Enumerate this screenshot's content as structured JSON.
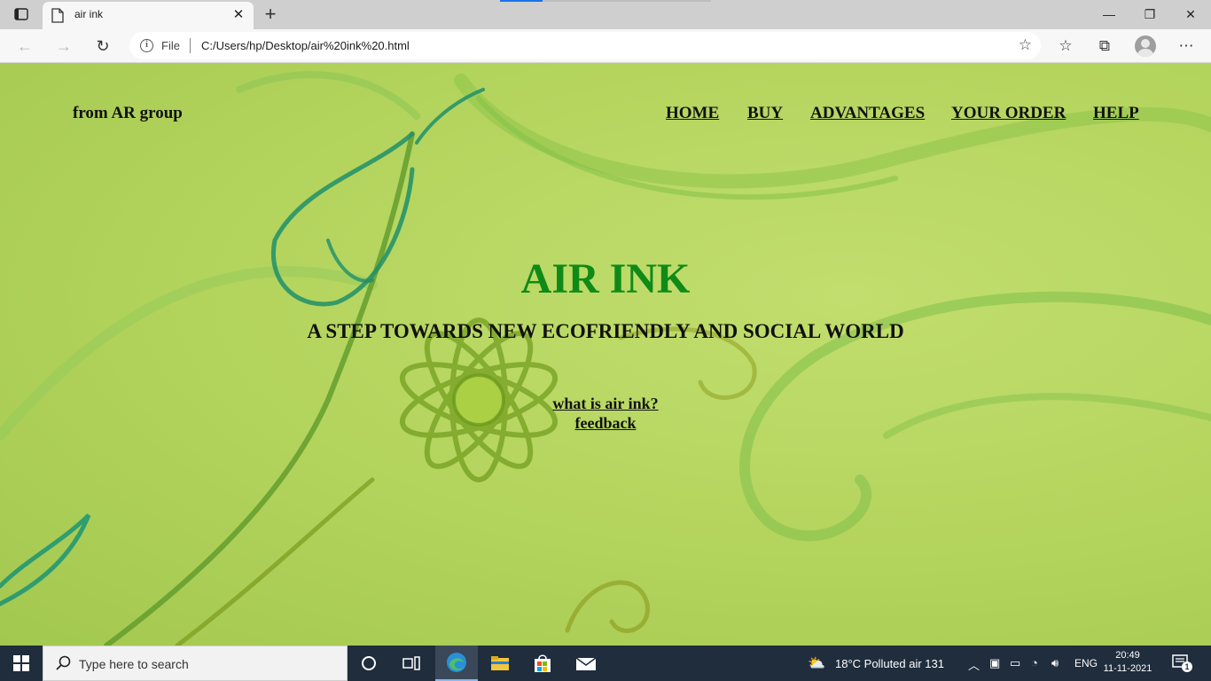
{
  "browser": {
    "tab_title": "air ink",
    "tab_close": "✕",
    "new_tab": "+",
    "address": {
      "file_label": "File",
      "url": "C:/Users/hp/Desktop/air%20ink%20.html"
    },
    "window_controls": {
      "minimize": "—",
      "maximize": "❐",
      "close": "✕"
    }
  },
  "page": {
    "brand": "from AR group",
    "nav": [
      "HOME",
      "BUY",
      "ADVANTAGES",
      "YOUR ORDER",
      "HELP"
    ],
    "hero_title": "AIR INK",
    "hero_subtitle": "A STEP TOWARDS NEW ECOFRIENDLY AND SOCIAL WORLD",
    "links": [
      "what is air ink?",
      "feedback"
    ],
    "colors": {
      "title": "#0f8a17",
      "background": "#b3d45c"
    }
  },
  "taskbar": {
    "search_placeholder": "Type here to search",
    "weather": "18°C  Polluted air 131",
    "language": "ENG",
    "time": "20:49",
    "date": "11-11-2021",
    "notification_count": "1"
  }
}
